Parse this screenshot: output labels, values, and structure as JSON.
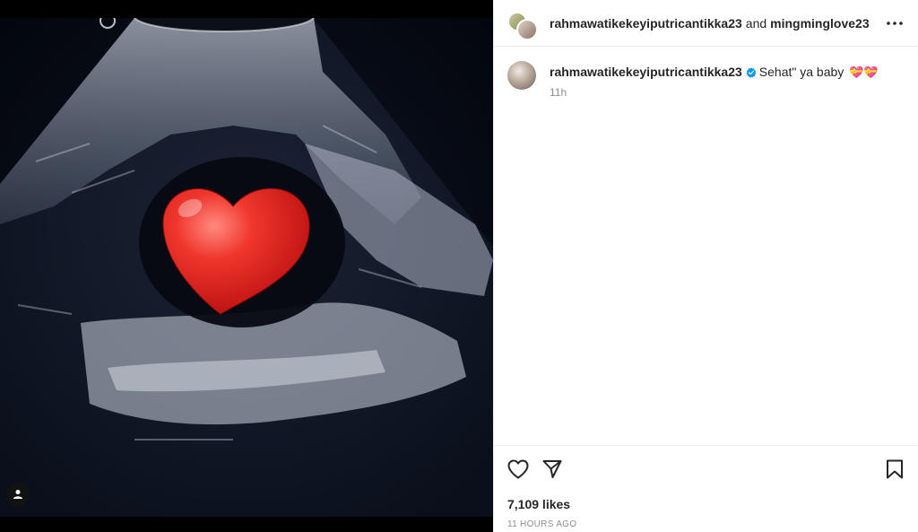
{
  "post": {
    "header": {
      "user1": "rahmawatikekeyiputricantikka23",
      "joiner": "and",
      "user2": "mingminglove23"
    },
    "caption": {
      "username": "rahmawatikekeyiputricantikka23",
      "text": "Sehat\" ya baby",
      "emojis": "💝💝",
      "time": "11h"
    },
    "likes": "7,109 likes",
    "timestamp": "11 HOURS AGO"
  },
  "icons": {
    "more": "more-horizontal-icon",
    "like": "heart-outline-icon",
    "share": "paper-plane-icon",
    "save": "bookmark-icon",
    "tag": "user-tag-icon",
    "verified": "verified-badge-icon"
  },
  "colors": {
    "verified_blue": "#0095f6",
    "heart_red": "#e0261f",
    "muted_text": "#8e8e8e"
  }
}
